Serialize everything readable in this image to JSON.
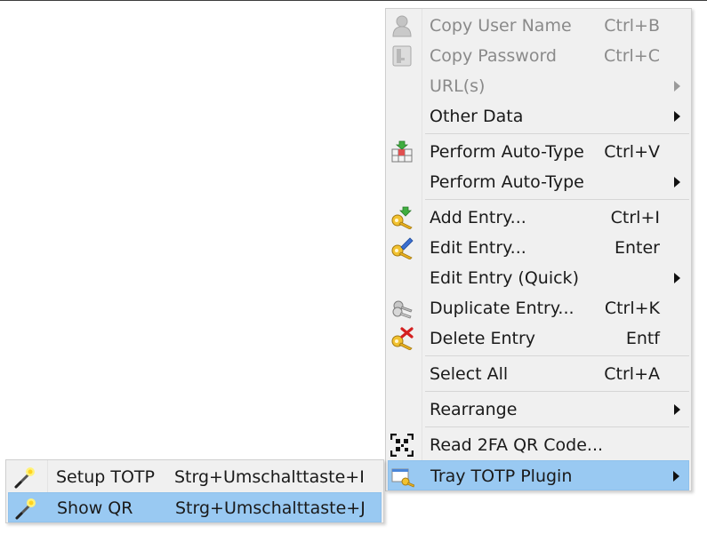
{
  "context_menu": {
    "items": [
      {
        "label": "Copy User Name",
        "shortcut": "Ctrl+B",
        "icon": "user-icon",
        "disabled": true
      },
      {
        "label": "Copy Password",
        "shortcut": "Ctrl+C",
        "icon": "key-icon",
        "disabled": true
      },
      {
        "label": "URL(s)",
        "shortcut": "",
        "icon": "",
        "disabled": true,
        "submenu": true
      },
      {
        "label": "Other Data",
        "shortcut": "",
        "icon": "",
        "submenu": true
      },
      {
        "label": "Perform Auto-Type",
        "shortcut": "Ctrl+V",
        "icon": "auto-type-icon"
      },
      {
        "label": "Perform Auto-Type",
        "shortcut": "",
        "icon": "",
        "submenu": true
      },
      {
        "label": "Add Entry...",
        "shortcut": "Ctrl+I",
        "icon": "add-entry-icon"
      },
      {
        "label": "Edit Entry...",
        "shortcut": "Enter",
        "icon": "edit-entry-icon"
      },
      {
        "label": "Edit Entry (Quick)",
        "shortcut": "",
        "icon": "",
        "submenu": true
      },
      {
        "label": "Duplicate Entry...",
        "shortcut": "Ctrl+K",
        "icon": "duplicate-entry-icon"
      },
      {
        "label": "Delete Entry",
        "shortcut": "Entf",
        "icon": "delete-entry-icon"
      },
      {
        "label": "Select All",
        "shortcut": "Ctrl+A",
        "icon": ""
      },
      {
        "label": "Rearrange",
        "shortcut": "",
        "icon": "",
        "submenu": true
      },
      {
        "label": "Read 2FA QR Code...",
        "shortcut": "",
        "icon": "qr-scan-icon"
      },
      {
        "label": "Tray TOTP Plugin",
        "shortcut": "",
        "icon": "tray-totp-icon",
        "submenu": true,
        "highlighted": true
      }
    ]
  },
  "submenu": {
    "items": [
      {
        "label": "Setup TOTP",
        "shortcut": "Strg+Umschalttaste+I",
        "icon": "wand-icon"
      },
      {
        "label": "Show QR",
        "shortcut": "Strg+Umschalttaste+J",
        "icon": "wand-icon",
        "highlighted": true
      }
    ]
  },
  "colors": {
    "menu_bg": "#f0f0f0",
    "highlight": "#99c9f2",
    "disabled_text": "#8a8a8a"
  }
}
